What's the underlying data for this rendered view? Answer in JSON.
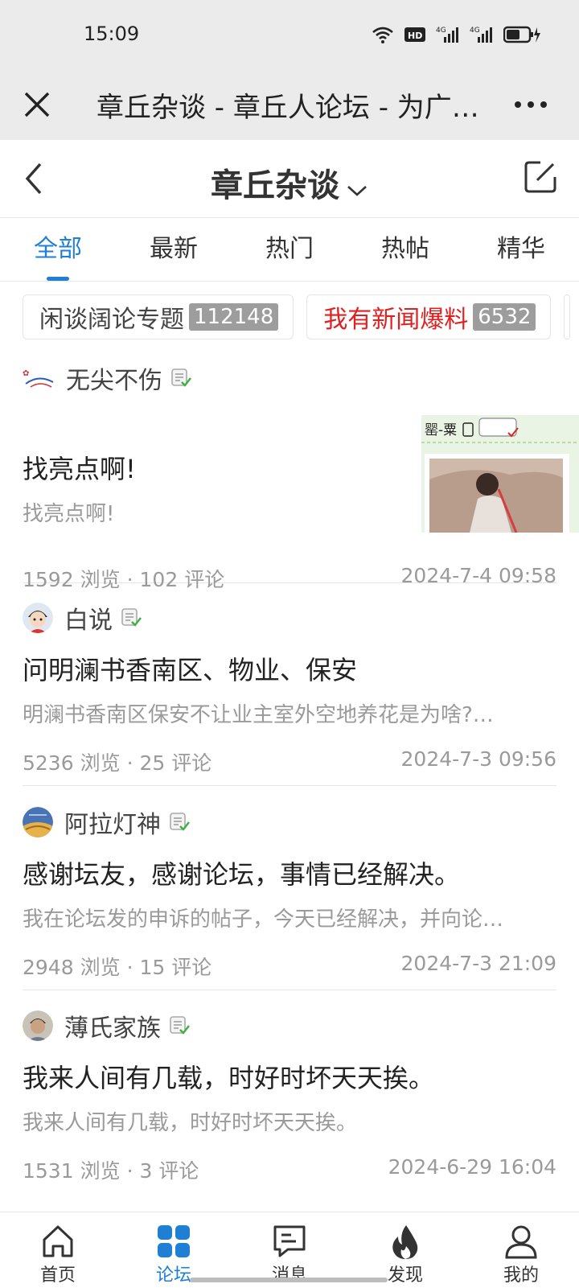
{
  "status": {
    "time": "15:09",
    "network1": "4G",
    "network2": "4G",
    "hd": "HD"
  },
  "browser": {
    "title": "章丘杂谈 - 章丘人论坛 - 为广…"
  },
  "header": {
    "title": "章丘杂谈"
  },
  "tabs": [
    "全部",
    "最新",
    "热门",
    "热帖",
    "精华"
  ],
  "topics": [
    {
      "name": "闲谈阔论专题",
      "count": "112148"
    },
    {
      "name": "我有新闻爆料",
      "count": "6532"
    }
  ],
  "posts": [
    {
      "author": "无尖不伤",
      "title": "找亮点啊!",
      "desc": "找亮点啊!",
      "views": "1592 浏览",
      "comments": "102 评论",
      "date": "2024-7-4 09:58",
      "thumb_label": "罂-粟"
    },
    {
      "author": "白说",
      "title": "问明澜书香南区、物业、保安",
      "desc": "明澜书香南区保安不让业主室外空地养花是为啥?…",
      "views": "5236 浏览",
      "comments": "25 评论",
      "date": "2024-7-3 09:56"
    },
    {
      "author": "阿拉灯神",
      "title": "感谢坛友，感谢论坛，事情已经解决。",
      "desc": "我在论坛发的申诉的帖子，今天已经解决，并向论…",
      "views": "2948 浏览",
      "comments": "15 评论",
      "date": "2024-7-3 21:09"
    },
    {
      "author": "薄氏家族",
      "title": "我来人间有几载，时好时坏天天挨。",
      "desc": "我来人间有几载，时好时坏天天挨。",
      "views": "1531 浏览",
      "comments": "3 评论",
      "date": "2024-6-29 16:04"
    }
  ],
  "nav": [
    "首页",
    "论坛",
    "消息",
    "发现",
    "我的"
  ],
  "colors": {
    "accent": "#1e7fd4",
    "red": "#e02020"
  }
}
